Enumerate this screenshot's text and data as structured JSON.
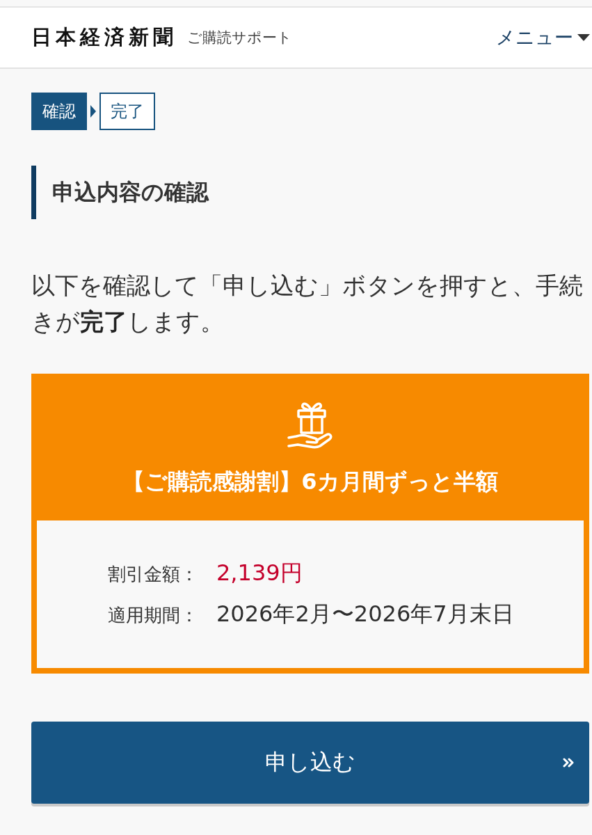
{
  "header": {
    "logo": "日本経済新聞",
    "subtitle": "ご購読サポート",
    "menu": {
      "label": "メニュー"
    }
  },
  "steps": [
    {
      "label": "確認",
      "selected": true
    },
    {
      "label": "完了",
      "selected": false
    }
  ],
  "heading": "申込内容の確認",
  "intro": "以下を確認して「申し込む」ボタンを押すと、手続きが**完了**します。",
  "offer": {
    "title": "【ご購読感謝割】6カ月間ずっと半額",
    "details": [
      {
        "kind": "amount",
        "label": "割引金額：",
        "value": "2,139円"
      },
      {
        "kind": "period",
        "label": "適用期間：",
        "value": "2026年2月〜2026年7月末日"
      }
    ]
  },
  "submit_button": {
    "label": "申し込む"
  }
}
